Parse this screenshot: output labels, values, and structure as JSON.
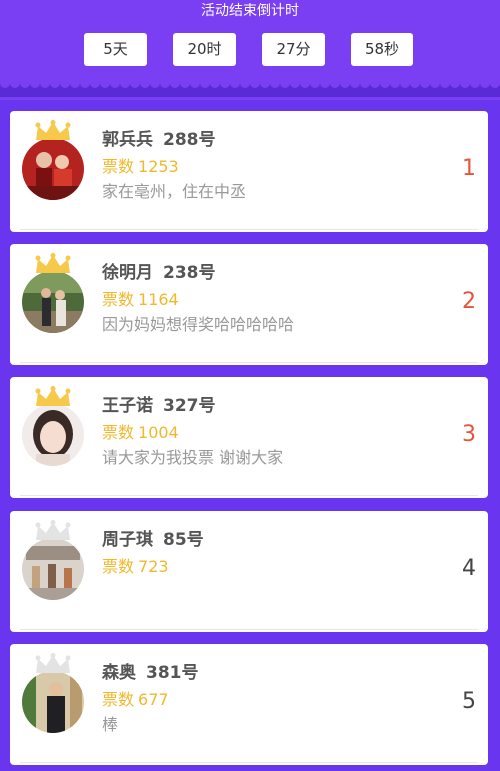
{
  "header": {
    "title": "活动结束倒计时",
    "countdown": [
      {
        "label": "5天"
      },
      {
        "label": "20时"
      },
      {
        "label": "27分"
      },
      {
        "label": "58秒"
      }
    ]
  },
  "colors": {
    "background": "#6a35ee",
    "header": "#7a3ff3",
    "votes": "#f1b82e",
    "rank_top": "#e6543a",
    "rank_other": "#444444",
    "crown_gold": "#f6c94a",
    "crown_silver": "#e3e3e3"
  },
  "entries": [
    {
      "name": "郭兵兵",
      "number": "288号",
      "votes_label": "票数",
      "votes": "1253",
      "desc": "家在亳州，住在中丞",
      "rank": "1",
      "crown": "crown-gold-icon"
    },
    {
      "name": "徐明月",
      "number": "238号",
      "votes_label": "票数",
      "votes": "1164",
      "desc": "因为妈妈想得奖哈哈哈哈哈",
      "rank": "2",
      "crown": "crown-gold-icon"
    },
    {
      "name": "王子诺",
      "number": "327号",
      "votes_label": "票数",
      "votes": "1004",
      "desc": "请大家为我投票 谢谢大家",
      "rank": "3",
      "crown": "crown-gold-icon"
    },
    {
      "name": "周子琪",
      "number": "85号",
      "votes_label": "票数",
      "votes": "723",
      "desc": "",
      "rank": "4",
      "crown": "crown-silver-icon"
    },
    {
      "name": "森奥",
      "number": "381号",
      "votes_label": "票数",
      "votes": "677",
      "desc": "棒",
      "rank": "5",
      "crown": "crown-silver-icon"
    }
  ]
}
